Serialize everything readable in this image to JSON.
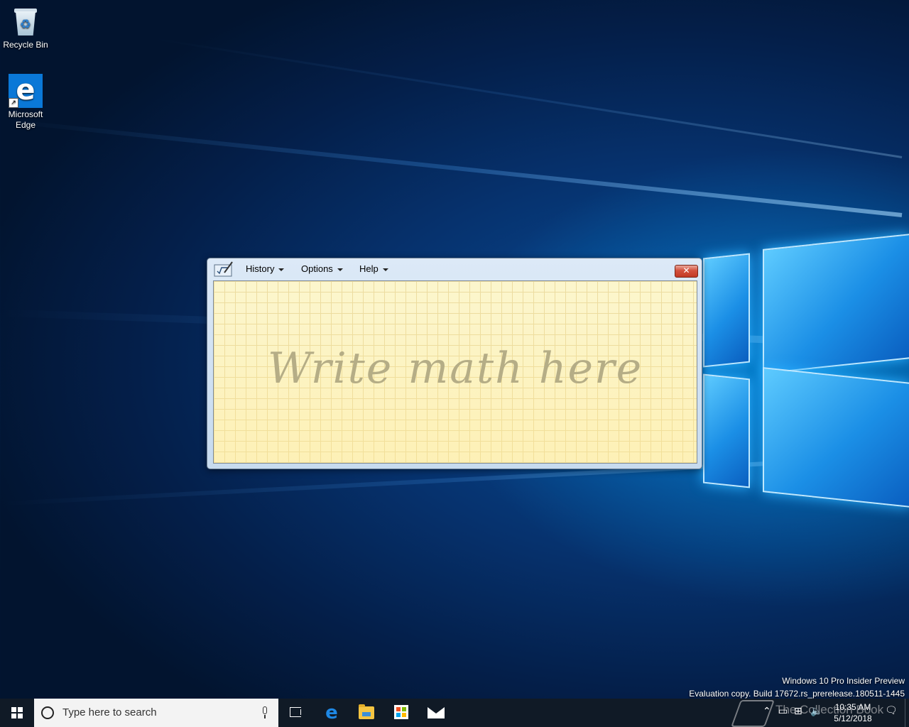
{
  "desktop": {
    "icons": [
      {
        "label": "Recycle Bin"
      },
      {
        "label": "Microsoft Edge"
      }
    ]
  },
  "math_input": {
    "menu": [
      "History",
      "Options",
      "Help"
    ],
    "close_label": "✕",
    "placeholder": "Write math here"
  },
  "watermark": {
    "line1": "Windows 10 Pro Insider Preview",
    "line2": "Evaluation copy. Build 17672.rs_prerelease.180511-1445"
  },
  "taskbar": {
    "search_placeholder": "Type here to search",
    "pinned": [
      "task-view",
      "edge",
      "file-explorer",
      "store",
      "mail"
    ],
    "tray_overlay_text": "The Collection Book",
    "time": "10:35 AM",
    "date": "5/12/2018"
  },
  "colors": {
    "taskbar": "#101a26",
    "write_area": "#fcf6cd",
    "close_button": "#c23a24"
  }
}
